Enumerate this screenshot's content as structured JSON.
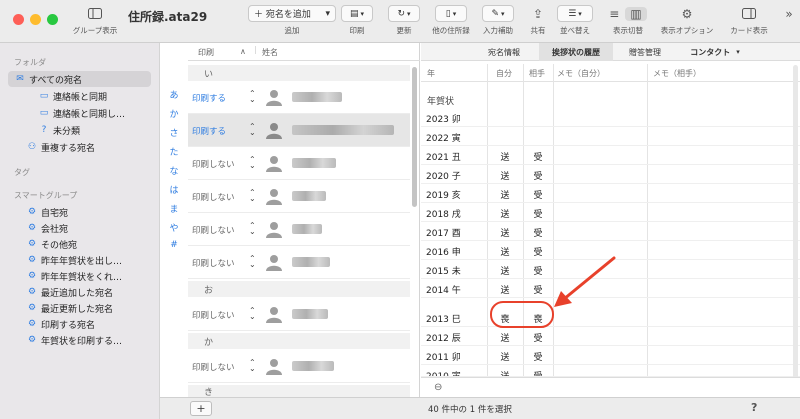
{
  "window": {
    "title": "住所録.ata29"
  },
  "toolbar": {
    "group_label": "グループ表示",
    "add_button": "＋ 宛名を追加",
    "add_label": "追加",
    "print_label": "印刷",
    "update_label": "更新",
    "other_book_label": "他の住所録",
    "input_assist_label": "入力補助",
    "share_label": "共有",
    "sort_label": "並べ替え",
    "view_switch_label": "表示切替",
    "view_options_label": "表示オプション",
    "card_view_label": "カード表示"
  },
  "sidebar": {
    "folder_header": "フォルダ",
    "folders": [
      {
        "label": "すべての宛名",
        "icon": "envelope-icon",
        "selected": true
      },
      {
        "label": "連絡帳と同期",
        "icon": "folder-icon"
      },
      {
        "label": "連絡帳と同期し…",
        "icon": "folder-icon"
      },
      {
        "label": "未分類",
        "icon": "question-icon"
      },
      {
        "label": "重複する宛名",
        "icon": "people-icon"
      }
    ],
    "tag_header": "タグ",
    "smart_header": "スマートグループ",
    "smart_groups": [
      "自宅宛",
      "会社宛",
      "その他宛",
      "昨年年賀状を出し…",
      "昨年年賀状をくれ…",
      "最近追加した宛名",
      "最近更新した宛名",
      "印刷する宛名",
      "年賀状を印刷する…"
    ]
  },
  "index_strip": [
    "あ",
    "か",
    "さ",
    "た",
    "な",
    "は",
    "ま",
    "や",
    "#"
  ],
  "list": {
    "header_print": "印刷",
    "header_sort": "∧",
    "header_name": "姓名",
    "section_i": "い",
    "section_o": "お",
    "section_ka": "か",
    "section_ki": "き",
    "rows": [
      {
        "print": "印刷する",
        "on": true
      },
      {
        "print": "印刷する",
        "on": true,
        "selected": true
      },
      {
        "print": "印刷しない",
        "on": false
      },
      {
        "print": "印刷しない",
        "on": false
      },
      {
        "print": "印刷しない",
        "on": false
      },
      {
        "print": "印刷しない",
        "on": false
      },
      {
        "print": "印刷しない",
        "on": false
      },
      {
        "print": "印刷しない",
        "on": false
      }
    ]
  },
  "detail": {
    "tabs": [
      "宛名情報",
      "挨拶状の履歴",
      "贈答管理",
      "コンタクト"
    ],
    "active_tab": "挨拶状の履歴",
    "columns": {
      "year": "年",
      "self": "自分",
      "partner": "相手",
      "memo_self": "メモ（自分）",
      "memo_partner": "メモ（相手）"
    },
    "section": "年賀状",
    "years": [
      {
        "year": "2023 卯",
        "self": "",
        "partner": ""
      },
      {
        "year": "2022 寅",
        "self": "",
        "partner": ""
      },
      {
        "year": "2021 丑",
        "self": "送",
        "partner": "受"
      },
      {
        "year": "2020 子",
        "self": "送",
        "partner": "受"
      },
      {
        "year": "2019 亥",
        "self": "送",
        "partner": "受"
      },
      {
        "year": "2018 戌",
        "self": "送",
        "partner": "受"
      },
      {
        "year": "2017 酉",
        "self": "送",
        "partner": "受"
      },
      {
        "year": "2016 申",
        "self": "送",
        "partner": "受"
      },
      {
        "year": "2015 未",
        "self": "送",
        "partner": "受"
      },
      {
        "year": "2014 午",
        "self": "送",
        "partner": "受"
      },
      {
        "year": "2013 巳",
        "self": "喪",
        "partner": "喪"
      },
      {
        "year": "2012 辰",
        "self": "送",
        "partner": "受"
      },
      {
        "year": "2011 卯",
        "self": "送",
        "partner": "受"
      },
      {
        "year": "2010 寅",
        "self": "送",
        "partner": "受"
      }
    ]
  },
  "status": {
    "selection": "40 件中の 1 件を選択",
    "add": "+",
    "help": "?"
  },
  "colors": {
    "accent": "#2f7de1",
    "annotation": "#e8412b"
  }
}
